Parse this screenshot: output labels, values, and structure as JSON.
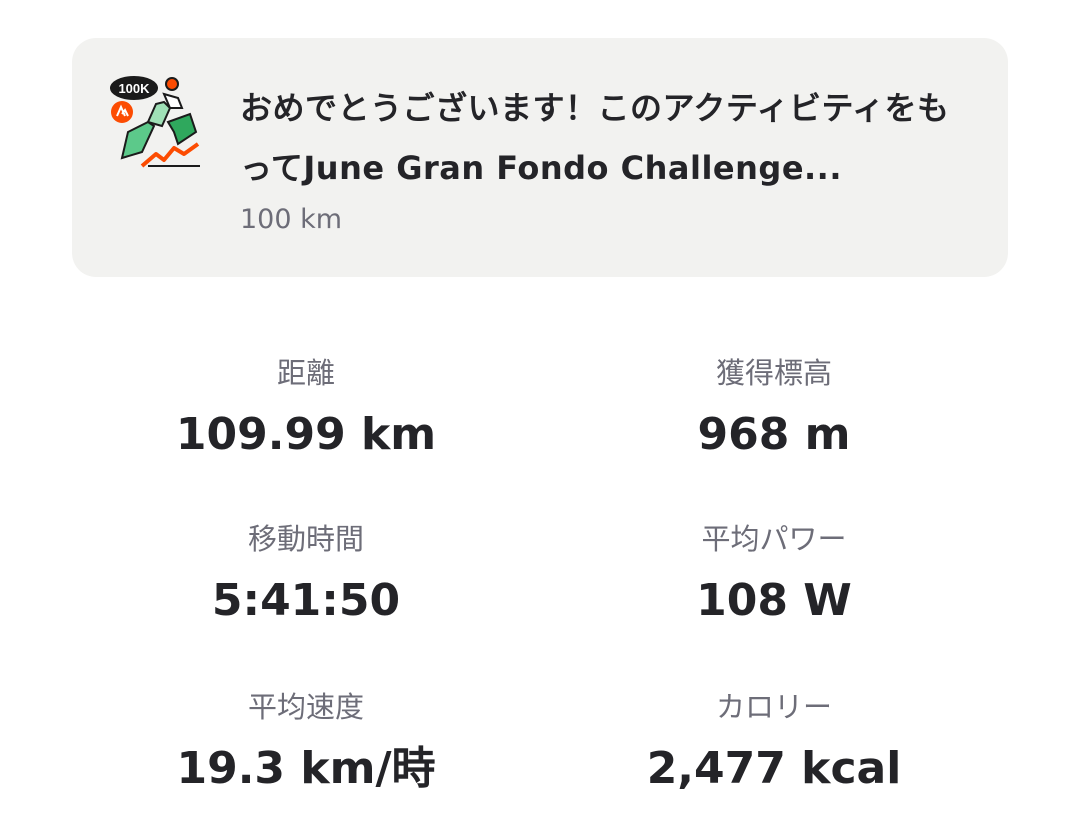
{
  "challenge": {
    "title": "おめでとうございます！このアクティビティをもってJune Gran Fondo Challenge...",
    "subtitle": "100 km",
    "badge_icon": "challenge-badge-100k-icon",
    "badge_text": "100K"
  },
  "stats": [
    {
      "label": "距離",
      "value": "109.99 km"
    },
    {
      "label": "獲得標高",
      "value": "968 m"
    },
    {
      "label": "移動時間",
      "value": "5:41:50"
    },
    {
      "label": "平均パワー",
      "value": "108 W"
    },
    {
      "label": "平均速度",
      "value": "19.3 km/時"
    },
    {
      "label": "カロリー",
      "value": "2,477 kcal"
    }
  ],
  "colors": {
    "card_background": "#f2f2f0",
    "badge_green": "#3dbf6e",
    "badge_orange": "#fc4c02",
    "text_primary": "#242428",
    "text_secondary": "#6d6d78"
  }
}
